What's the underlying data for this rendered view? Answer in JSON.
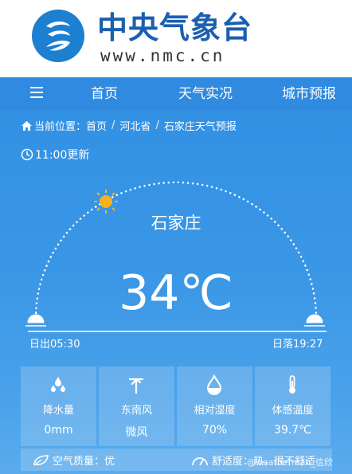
{
  "brand": {
    "name_cn": "中央气象台",
    "domain": "www.nmc.cn"
  },
  "nav": {
    "home": "首页",
    "live": "天气实况",
    "forecast": "城市预报"
  },
  "breadcrumb": {
    "prefix": "当前位置：",
    "items": [
      "首页",
      "河北省",
      "石家庄天气预报"
    ]
  },
  "update_time": "11:00更新",
  "city": "石家庄",
  "temperature": "34℃",
  "sunrise": "日出05:30",
  "sunset": "日落19:27",
  "cards": [
    {
      "icon": "raindrops-icon",
      "label": "降水量",
      "value": "0mm"
    },
    {
      "icon": "wind-icon",
      "label": "东南风",
      "value": "微风"
    },
    {
      "icon": "humidity-drop-icon",
      "label": "相对湿度",
      "value": "70%"
    },
    {
      "icon": "thermometer-icon",
      "label": "体感温度",
      "value": "39.7℃"
    }
  ],
  "air_quality": "空气质量：优",
  "comfort": "舒适度：热，很不舒适",
  "watermark": "@weatherman_信欣",
  "colors": {
    "brand_blue": "#1a5fb0",
    "nav_blue": "#2f8ae0",
    "sun": "#f6b21e"
  }
}
